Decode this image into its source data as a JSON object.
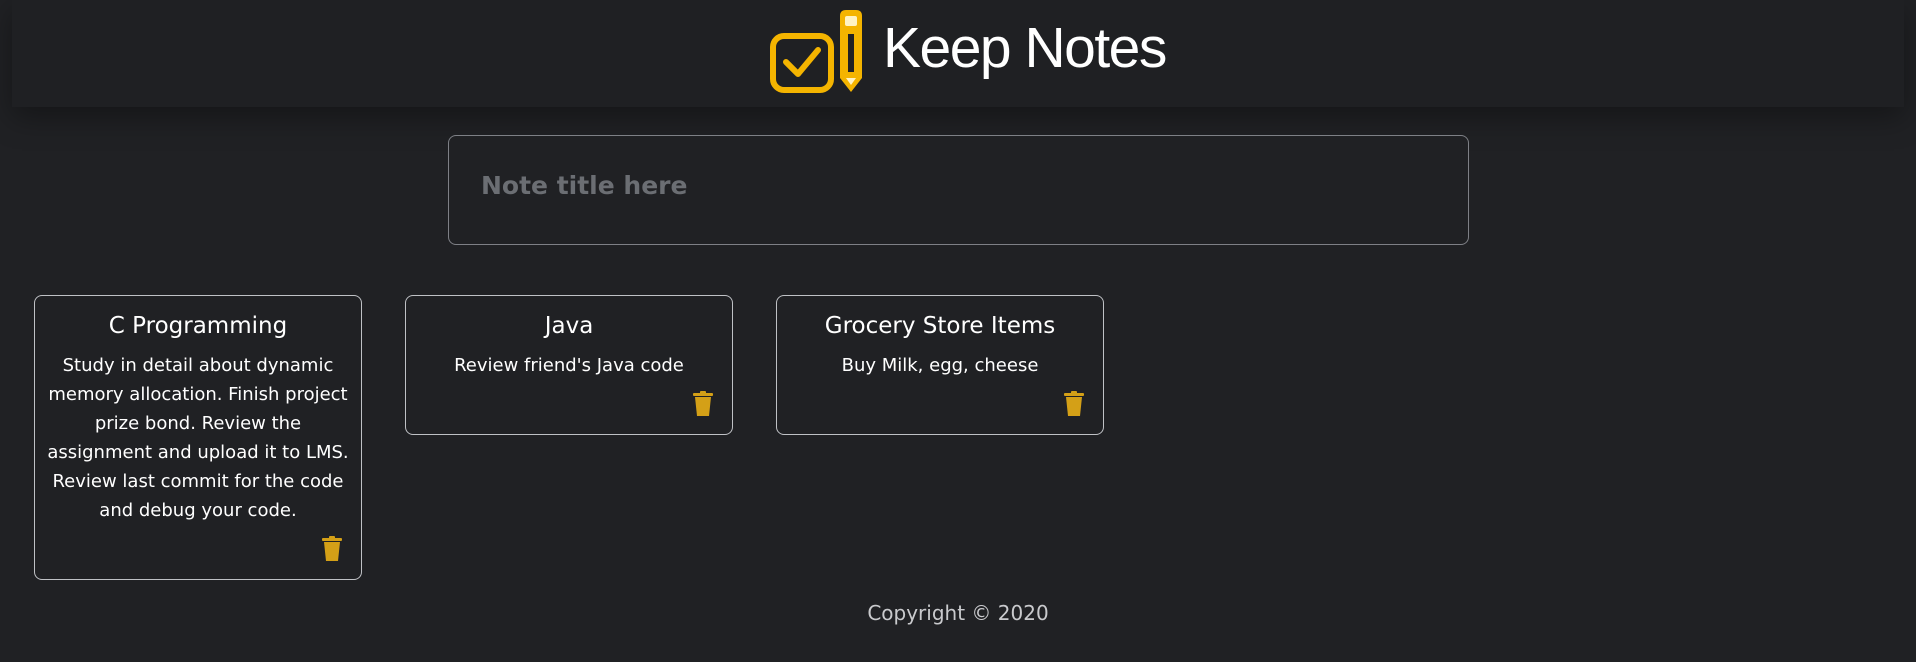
{
  "header": {
    "app_title": "Keep Notes",
    "logo_icon": "checkbox-pencil-icon",
    "accent_color": "#f4b400"
  },
  "composer": {
    "title_placeholder": "Note title here",
    "title_value": ""
  },
  "notes": [
    {
      "title": "C Programming",
      "content": "Study in detail about dynamic memory allocation. Finish project prize bond. Review the assignment and upload it to LMS. Review last commit for the code and debug your code.",
      "delete_icon": "trash-icon"
    },
    {
      "title": "Java",
      "content": "Review friend's Java code",
      "delete_icon": "trash-icon"
    },
    {
      "title": "Grocery Store Items",
      "content": "Buy Milk, egg, cheese",
      "delete_icon": "trash-icon"
    }
  ],
  "footer": {
    "copyright": "Copyright © 2020"
  }
}
